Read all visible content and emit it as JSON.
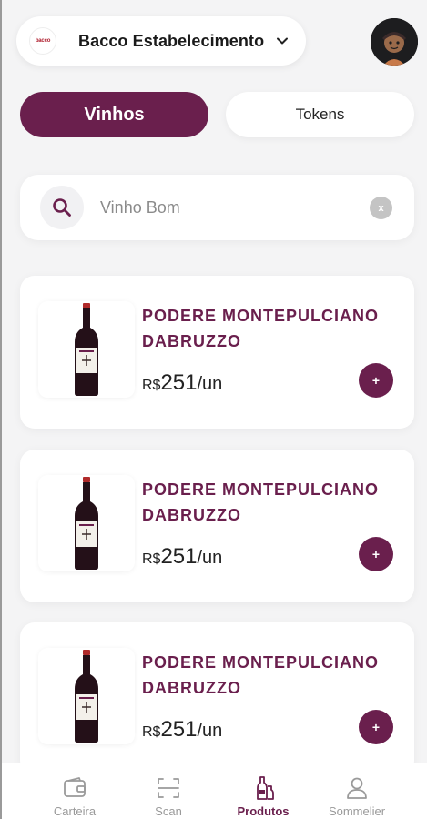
{
  "header": {
    "establishment_logo_text": "bacco",
    "establishment_name": "Bacco Estabelecimento"
  },
  "tabs": [
    {
      "label": "Vinhos",
      "active": true
    },
    {
      "label": "Tokens",
      "active": false
    }
  ],
  "search": {
    "value": "",
    "placeholder": "Vinho Bom",
    "clear_label": "x"
  },
  "products": [
    {
      "name": "PODERE MONTEPULCIANO DABRUZZO",
      "currency": "R$",
      "price": "251",
      "unit": "/un",
      "add_label": "+"
    },
    {
      "name": "PODERE MONTEPULCIANO DABRUZZO",
      "currency": "R$",
      "price": "251",
      "unit": "/un",
      "add_label": "+"
    },
    {
      "name": "PODERE MONTEPULCIANO DABRUZZO",
      "currency": "R$",
      "price": "251",
      "unit": "/un",
      "add_label": "+"
    }
  ],
  "bottom_nav": [
    {
      "label": "Carteira",
      "icon": "wallet-icon",
      "active": false
    },
    {
      "label": "Scan",
      "icon": "scan-icon",
      "active": false
    },
    {
      "label": "Produtos",
      "icon": "bottles-icon",
      "active": true
    },
    {
      "label": "Sommelier",
      "icon": "user-icon",
      "active": false
    }
  ],
  "colors": {
    "accent": "#6a1f4d",
    "background": "#f4f4f5",
    "inactive": "#9a9a9a"
  }
}
